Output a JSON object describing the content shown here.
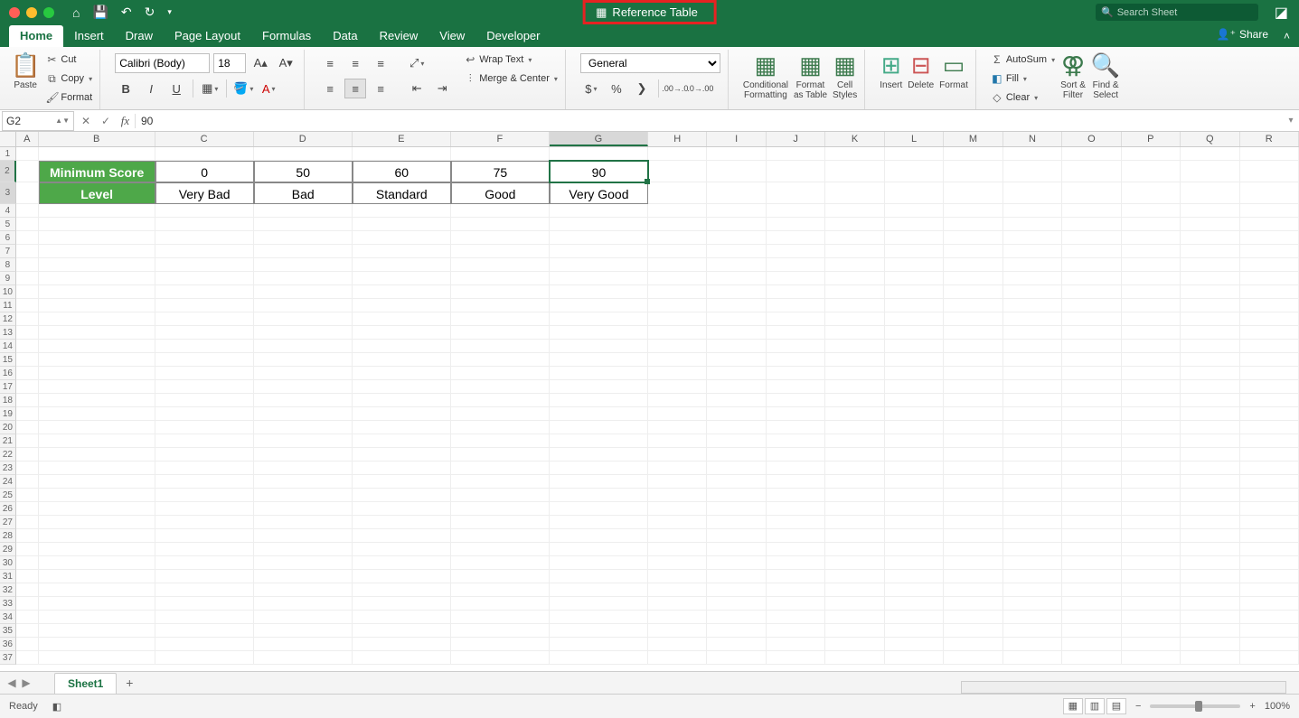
{
  "window": {
    "title": "Reference Table"
  },
  "search": {
    "placeholder": "Search Sheet"
  },
  "tabs": {
    "items": [
      "Home",
      "Insert",
      "Draw",
      "Page Layout",
      "Formulas",
      "Data",
      "Review",
      "View",
      "Developer"
    ],
    "active": "Home",
    "share": "Share"
  },
  "ribbon": {
    "clipboard": {
      "paste": "Paste",
      "cut": "Cut",
      "copy": "Copy",
      "format": "Format"
    },
    "font": {
      "name": "Calibri (Body)",
      "size": "18"
    },
    "alignment": {
      "wrap": "Wrap Text",
      "merge": "Merge & Center"
    },
    "number": {
      "format": "General"
    },
    "styles": {
      "cond": "Conditional\nFormatting",
      "fat": "Format\nas Table",
      "cell": "Cell\nStyles"
    },
    "cells": {
      "insert": "Insert",
      "delete": "Delete",
      "format": "Format"
    },
    "editing": {
      "autosum": "AutoSum",
      "fill": "Fill",
      "clear": "Clear",
      "sort": "Sort &\nFilter",
      "find": "Find &\nSelect"
    }
  },
  "formula_bar": {
    "name_box": "G2",
    "value": "90"
  },
  "columns": [
    "A",
    "B",
    "C",
    "D",
    "E",
    "F",
    "G",
    "H",
    "I",
    "J",
    "K",
    "L",
    "M",
    "N",
    "O",
    "P",
    "Q",
    "R"
  ],
  "col_widths": {
    "A": 25,
    "B": 130,
    "C": 110,
    "D": 110,
    "E": 110,
    "F": 110,
    "G": 110,
    "other": 66
  },
  "selected_cell": {
    "col": "G",
    "row": 2
  },
  "data": {
    "row2": {
      "header": "Minimum Score",
      "vals": [
        "0",
        "50",
        "60",
        "75",
        "90"
      ]
    },
    "row3": {
      "header": "Level",
      "vals": [
        "Very Bad",
        "Bad",
        "Standard",
        "Good",
        "Very Good"
      ]
    }
  },
  "sheet_tab": "Sheet1",
  "status": {
    "ready": "Ready",
    "zoom": "100%"
  }
}
